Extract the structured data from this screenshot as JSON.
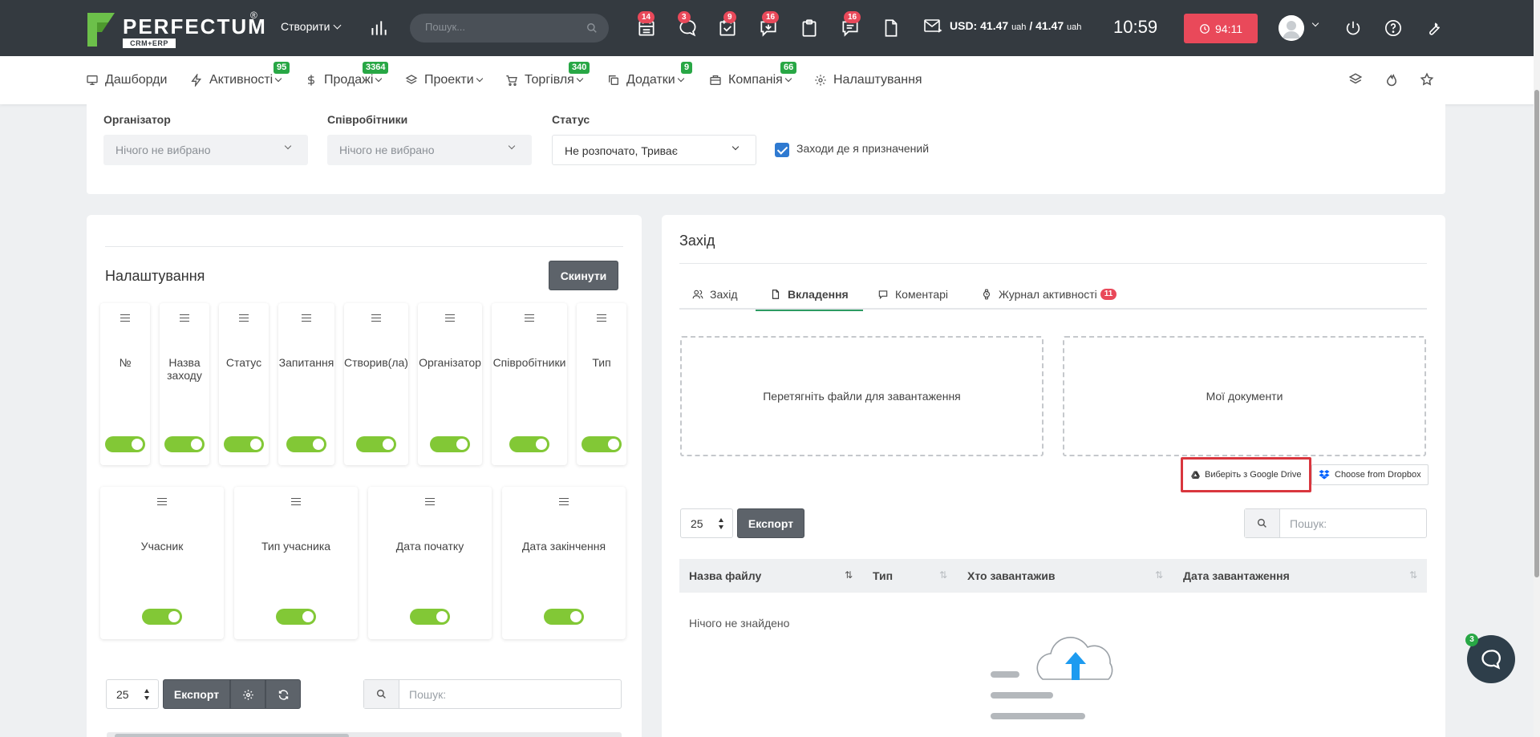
{
  "brand": {
    "name": "PERFECTUM",
    "reg": "®",
    "sub": "CRM+ERP",
    "color_green": "#6cc04a"
  },
  "topbar": {
    "create_label": "Створити",
    "search_placeholder": "Пошук...",
    "badges": {
      "calendar": "14",
      "chat": "3",
      "tasks": "9",
      "messages": "16",
      "comments": "16"
    },
    "currency": {
      "usd_label": "USD:",
      "rate1": "41.47",
      "unit1": "uah",
      "separator": "/",
      "rate2": "41.47",
      "unit2": "uah"
    },
    "clock": "10:59",
    "timer": "94:11"
  },
  "nav": {
    "items": [
      {
        "label": "Дашборди",
        "icon": "monitor-icon"
      },
      {
        "label": "Активності",
        "badge": "95",
        "icon": "bolt-icon"
      },
      {
        "label": "Продажі",
        "badge": "3364",
        "icon": "dollar-icon"
      },
      {
        "label": "Проекти",
        "icon": "layers-icon"
      },
      {
        "label": "Торгівля",
        "badge": "340",
        "icon": "cart-icon"
      },
      {
        "label": "Додатки",
        "badge": "9",
        "icon": "copy-icon"
      },
      {
        "label": "Компанія",
        "badge": "66",
        "icon": "building-icon"
      },
      {
        "label": "Налаштування",
        "icon": "gear-icon"
      }
    ]
  },
  "filters": {
    "organizer": {
      "label": "Організатор",
      "value": "Нічого не вибрано"
    },
    "employees": {
      "label": "Співробітники",
      "value": "Нічого не вибрано"
    },
    "status": {
      "label": "Статус",
      "value": "Не розпочато, Триває"
    },
    "assigned_checkbox": {
      "label": "Заходи де я призначений",
      "checked": true
    }
  },
  "settings": {
    "title": "Налаштування",
    "reset_label": "Скинути",
    "columns_row1": [
      {
        "label": "№",
        "enabled": true
      },
      {
        "label": "Назва заходу",
        "enabled": true
      },
      {
        "label": "Статус",
        "enabled": true
      },
      {
        "label": "Запитання",
        "enabled": true
      },
      {
        "label": "Створив(ла)",
        "enabled": true
      },
      {
        "label": "Організатор",
        "enabled": true
      },
      {
        "label": "Співробітники",
        "enabled": true
      },
      {
        "label": "Тип",
        "enabled": true
      }
    ],
    "columns_row2": [
      {
        "label": "Учасник",
        "enabled": true
      },
      {
        "label": "Тип учасника",
        "enabled": true
      },
      {
        "label": "Дата початку",
        "enabled": true
      },
      {
        "label": "Дата закінчення",
        "enabled": true
      }
    ],
    "page_size": "25",
    "export_label": "Експорт",
    "search_placeholder": "Пошук:"
  },
  "event": {
    "title": "Захід",
    "tabs": [
      {
        "label": "Захід",
        "icon": "users-icon",
        "active": false
      },
      {
        "label": "Вкладення",
        "icon": "file-icon",
        "active": true
      },
      {
        "label": "Коментарі",
        "icon": "comment-icon",
        "active": false
      },
      {
        "label": "Журнал активності",
        "icon": "watch-icon",
        "active": false,
        "badge": "11"
      }
    ],
    "dropzone_label": "Перетягніть файли для завантаження",
    "my_docs_label": "Мої документи",
    "google_drive_label": "Виберіть з Google Drive",
    "dropbox_label": "Choose from Dropbox",
    "page_size": "25",
    "export_label": "Експорт",
    "search_placeholder": "Пошук:",
    "table_headers": [
      "Назва файлу",
      "Тип",
      "Хто завантажив",
      "Дата завантаження"
    ],
    "empty_text": "Нічого не знайдено"
  },
  "chat": {
    "badge": "3"
  }
}
